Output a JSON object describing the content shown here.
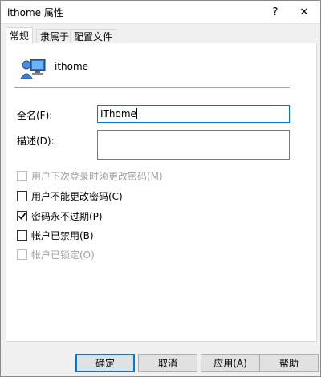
{
  "window": {
    "title": "ithome 属性",
    "help_glyph": "?",
    "close_glyph": "✕"
  },
  "tabs": [
    {
      "label": "常规",
      "active": true
    },
    {
      "label": "隶属于",
      "active": false
    },
    {
      "label": "配置文件",
      "active": false
    }
  ],
  "general": {
    "username": "ithome",
    "fullname_label": "全名(F):",
    "fullname_value": "IThome",
    "description_label": "描述(D):",
    "description_value": "",
    "checkboxes": [
      {
        "label": "用户下次登录时须更改密码(M)",
        "checked": false,
        "disabled": true
      },
      {
        "label": "用户不能更改密码(C)",
        "checked": false,
        "disabled": false
      },
      {
        "label": "密码永不过期(P)",
        "checked": true,
        "disabled": false
      },
      {
        "label": "帐户已禁用(B)",
        "checked": false,
        "disabled": false
      },
      {
        "label": "帐户已锁定(O)",
        "checked": false,
        "disabled": true
      }
    ]
  },
  "buttons": {
    "ok": "确定",
    "cancel": "取消",
    "apply": "应用(A)",
    "help": "帮助"
  },
  "colors": {
    "accent": "#0078d7",
    "disabled_text": "#a0a0a0"
  }
}
